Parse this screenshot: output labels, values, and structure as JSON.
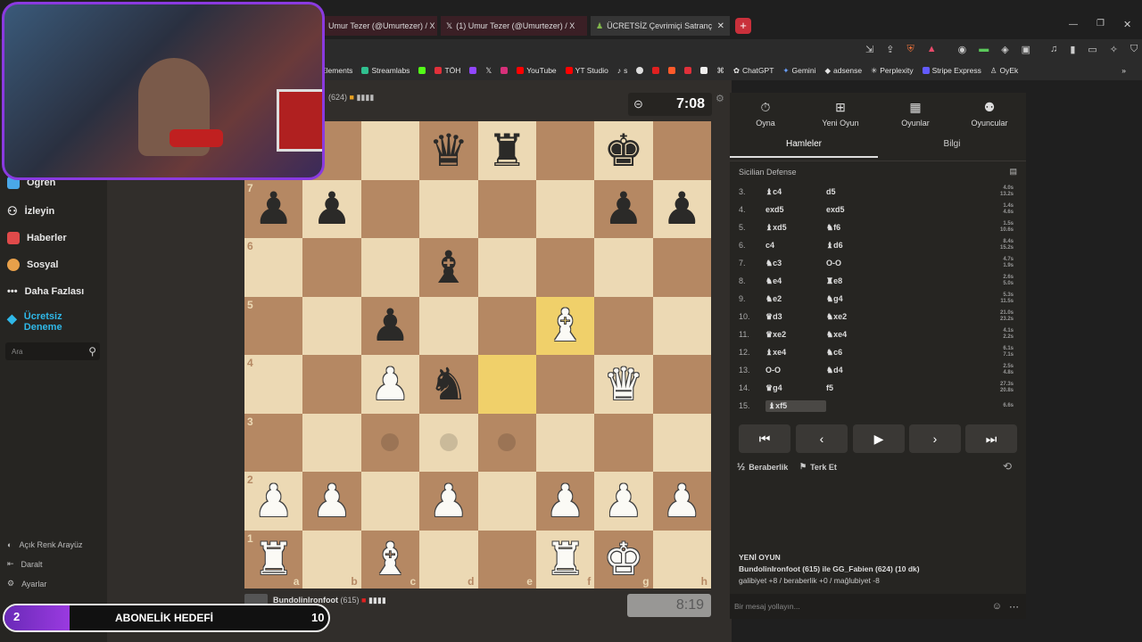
{
  "browser": {
    "tabs": [
      {
        "label": "Umur Tezer (@Umurtezer) / X"
      },
      {
        "label": "(1) Umur Tezer (@Umurtezer) / X"
      },
      {
        "label": "ÜCRETSİZ Çevrimiçi Satranç Oyn"
      }
    ],
    "new_tab": "+",
    "bookmarks": [
      "Elements",
      "Streamlabs",
      "TÖH",
      "YouTube",
      "YT Studio",
      "s",
      "ChatGPT",
      "Gemini",
      "adsense",
      "Perplexity",
      "Stripe Express",
      "OyEk"
    ]
  },
  "sidebar": {
    "items": [
      {
        "label": "Öğren",
        "icon": "learn-icon",
        "color": "#4aa8e8"
      },
      {
        "label": "İzleyin",
        "icon": "binoculars-icon",
        "color": "#cccccc"
      },
      {
        "label": "Haberler",
        "icon": "news-icon",
        "color": "#e04a4a"
      },
      {
        "label": "Sosyal",
        "icon": "social-icon",
        "color": "#e8a04a"
      },
      {
        "label": "Daha Fazlası",
        "icon": "more-icon",
        "color": "#cccccc"
      },
      {
        "label": "Ücretsiz Deneme",
        "icon": "diamond-icon",
        "color": "#2fb8e8"
      }
    ],
    "search_placeholder": "Ara",
    "bottom": [
      {
        "label": "Açık Renk Arayüz",
        "icon": "theme-icon"
      },
      {
        "label": "Daralt",
        "icon": "collapse-icon"
      },
      {
        "label": "Ayarlar",
        "icon": "settings-icon"
      }
    ]
  },
  "top_player": {
    "rating": "(624)",
    "clock": "7:08"
  },
  "bottom_player": {
    "name": "BundolinIronfoot",
    "rating": "(615)",
    "clock": "8:19"
  },
  "board": {
    "ranks": [
      "8",
      "7",
      "6",
      "5",
      "4",
      "3",
      "2",
      "1"
    ],
    "files": [
      "a",
      "b",
      "c",
      "d",
      "e",
      "f",
      "g",
      "h"
    ],
    "pieces": [
      [
        "",
        "",
        "",
        "bq",
        "br",
        "",
        "bk",
        ""
      ],
      [
        "bp",
        "bp",
        "",
        "",
        "",
        "",
        "bp",
        "bp"
      ],
      [
        "",
        "",
        "",
        "bb",
        "",
        "",
        "",
        ""
      ],
      [
        "",
        "",
        "bp",
        "",
        "",
        "wb",
        "",
        ""
      ],
      [
        "",
        "",
        "wp",
        "bn",
        "",
        "",
        "wq",
        ""
      ],
      [
        "",
        "",
        "",
        "",
        "",
        "",
        "",
        ""
      ],
      [
        "wp",
        "wp",
        "",
        "wp",
        "",
        "wp",
        "wp",
        "wp"
      ],
      [
        "wr",
        "",
        "wb",
        "",
        "",
        "wr",
        "wk",
        ""
      ]
    ],
    "highlights": [
      "f5",
      "e4"
    ],
    "move_dots": [
      "c3",
      "d3",
      "e3"
    ]
  },
  "panel": {
    "tabs": [
      {
        "label": "Oyna",
        "icon": "stopwatch-icon"
      },
      {
        "label": "Yeni Oyun",
        "icon": "plus-icon"
      },
      {
        "label": "Oyunlar",
        "icon": "board-icon"
      },
      {
        "label": "Oyuncular",
        "icon": "players-icon"
      }
    ],
    "subtabs": [
      "Hamleler",
      "Bilgi"
    ],
    "opening": "Sicilian Defense",
    "moves": [
      {
        "n": "3.",
        "w": "♝c4",
        "b": "d5",
        "tw": "4.0s",
        "tb": "13.2s"
      },
      {
        "n": "4.",
        "w": "exd5",
        "b": "exd5",
        "tw": "1.4s",
        "tb": "4.6s"
      },
      {
        "n": "5.",
        "w": "♝xd5",
        "b": "♞f6",
        "tw": "1.5s",
        "tb": "10.6s"
      },
      {
        "n": "6.",
        "w": "c4",
        "b": "♝d6",
        "tw": "8.4s",
        "tb": "15.2s"
      },
      {
        "n": "7.",
        "w": "♞c3",
        "b": "O-O",
        "tw": "4.7s",
        "tb": "1.9s"
      },
      {
        "n": "8.",
        "w": "♞e4",
        "b": "♜e8",
        "tw": "2.6s",
        "tb": "5.0s"
      },
      {
        "n": "9.",
        "w": "♞e2",
        "b": "♞g4",
        "tw": "5.3s",
        "tb": "11.5s"
      },
      {
        "n": "10.",
        "w": "♛d3",
        "b": "♞xe2",
        "tw": "21.0s",
        "tb": "23.2s"
      },
      {
        "n": "11.",
        "w": "♛xe2",
        "b": "♞xe4",
        "tw": "4.1s",
        "tb": "2.2s"
      },
      {
        "n": "12.",
        "w": "♝xe4",
        "b": "♞c6",
        "tw": "6.1s",
        "tb": "7.1s"
      },
      {
        "n": "13.",
        "w": "O-O",
        "b": "♞d4",
        "tw": "2.5s",
        "tb": "4.8s"
      },
      {
        "n": "14.",
        "w": "♛g4",
        "b": "f5",
        "tw": "27.3s",
        "tb": "20.8s"
      },
      {
        "n": "15.",
        "w": "♝xf5",
        "b": "",
        "tw": "6.6s",
        "tb": ""
      }
    ],
    "nav": [
      "⏮",
      "‹",
      "▶",
      "›",
      "⏭"
    ],
    "draw_label": "Beraberlik",
    "resign_label": "Terk Et",
    "new_game_title": "YENİ OYUN",
    "new_game_line": "BundolinIronfoot (615) ile GG_Fabien (624) (10 dk)",
    "new_game_stats": "galibiyet +8 / beraberlik +0 / mağlubiyet -8",
    "chat_placeholder": "Bir mesaj yollayın..."
  },
  "overlay": {
    "sub_current": "2",
    "sub_label": "ABONELİK HEDEFİ",
    "sub_goal": "10",
    "progress": 0.2
  }
}
